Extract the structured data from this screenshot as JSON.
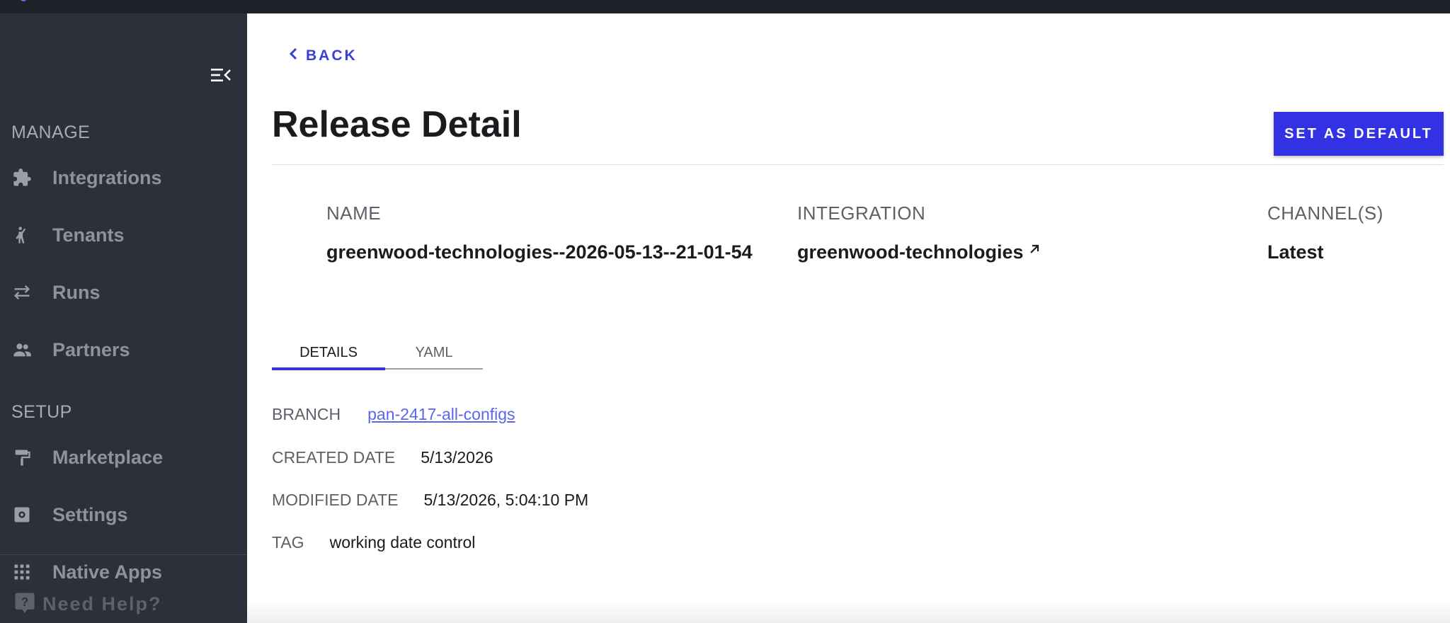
{
  "colors": {
    "sidebar_bg": "#2d303b",
    "topbar_bg": "#1f2128",
    "accent": "#3232e4",
    "link": "#5a67ea"
  },
  "sidebar": {
    "collapse_icon": "collapse-menu-icon",
    "sections": [
      {
        "label": "MANAGE",
        "items": [
          {
            "label": "Integrations",
            "icon": "puzzle-icon"
          },
          {
            "label": "Tenants",
            "icon": "person-waving-icon"
          },
          {
            "label": "Runs",
            "icon": "swap-arrows-icon"
          },
          {
            "label": "Partners",
            "icon": "people-icon"
          }
        ]
      },
      {
        "label": "SETUP",
        "items": [
          {
            "label": "Marketplace",
            "icon": "paint-roller-icon"
          },
          {
            "label": "Settings",
            "icon": "gear-box-icon"
          },
          {
            "label": "Native Apps",
            "icon": "grid-icon"
          }
        ]
      }
    ],
    "help": {
      "label": "Need Help?",
      "icon": "help-icon"
    }
  },
  "main": {
    "back_label": "BACK",
    "title": "Release Detail",
    "set_default_label": "SET AS DEFAULT",
    "meta": {
      "name": {
        "label": "NAME",
        "value": "greenwood-technologies--2026-05-13--21-01-54"
      },
      "integration": {
        "label": "INTEGRATION",
        "value": "greenwood-technologies"
      },
      "channels": {
        "label": "CHANNEL(S)",
        "value": "Latest"
      }
    },
    "tabs": [
      {
        "label": "DETAILS",
        "active": true
      },
      {
        "label": "YAML",
        "active": false
      }
    ],
    "details": {
      "branch": {
        "label": "BRANCH",
        "value": "pan-2417-all-configs"
      },
      "created": {
        "label": "CREATED DATE",
        "value": "5/13/2026"
      },
      "modified": {
        "label": "MODIFIED DATE",
        "value": "5/13/2026, 5:04:10 PM"
      },
      "tag": {
        "label": "TAG",
        "value": "working date control"
      }
    }
  }
}
